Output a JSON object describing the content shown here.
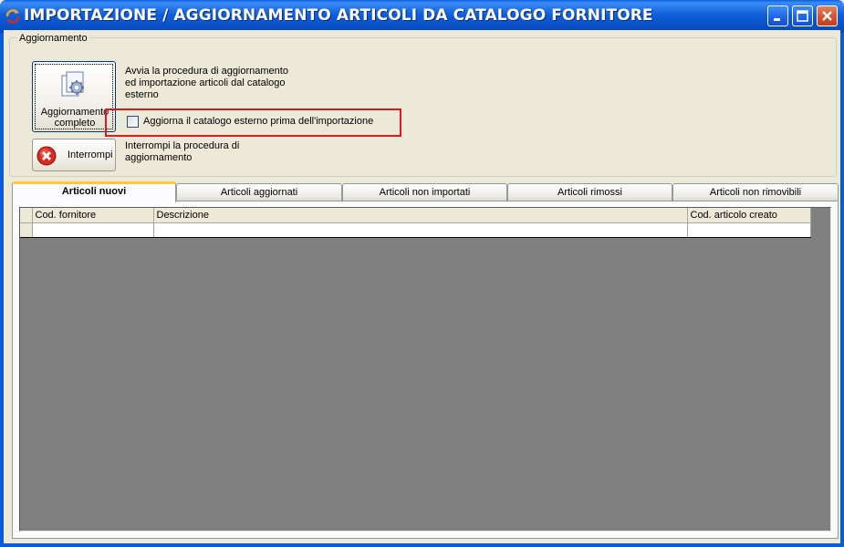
{
  "window": {
    "title": "IMPORTAZIONE / AGGIORNAMENTO ARTICOLI DA CATALOGO FORNITORE",
    "icons": [
      "app-icon",
      "minimize-icon",
      "maximize-icon",
      "close-icon"
    ]
  },
  "update_group": {
    "legend": "Aggiornamento",
    "full_update_button": {
      "label_line1": "Aggiornamento",
      "label_line2": "completo",
      "icon": "document-gear-icon"
    },
    "full_update_desc": "Avvia la procedura di aggiornamento ed importazione articoli dal catalogo esterno",
    "checkbox": {
      "label": "Aggiorna il catalogo esterno prima dell'importazione",
      "checked": false
    },
    "stop_button": {
      "label": "Interrompi",
      "icon": "red-x-icon"
    },
    "stop_desc": "Interrompi la procedura di aggiornamento"
  },
  "tabs": [
    {
      "label": "Articoli nuovi",
      "active": true
    },
    {
      "label": "Articoli aggiornati",
      "active": false
    },
    {
      "label": "Articoli non importati",
      "active": false
    },
    {
      "label": "Articoli rimossi",
      "active": false
    },
    {
      "label": "Articoli non rimovibili",
      "active": false
    }
  ],
  "grid": {
    "columns": [
      "Cod. fornitore",
      "Descrizione",
      "Cod. articolo creato"
    ],
    "rows": [
      [
        "",
        "",
        ""
      ]
    ]
  },
  "colors": {
    "titlebar": "#0A5BD7",
    "highlight_border": "#E01A1A",
    "grid_background": "#808080",
    "active_tab_accent": "#FFC83C"
  }
}
